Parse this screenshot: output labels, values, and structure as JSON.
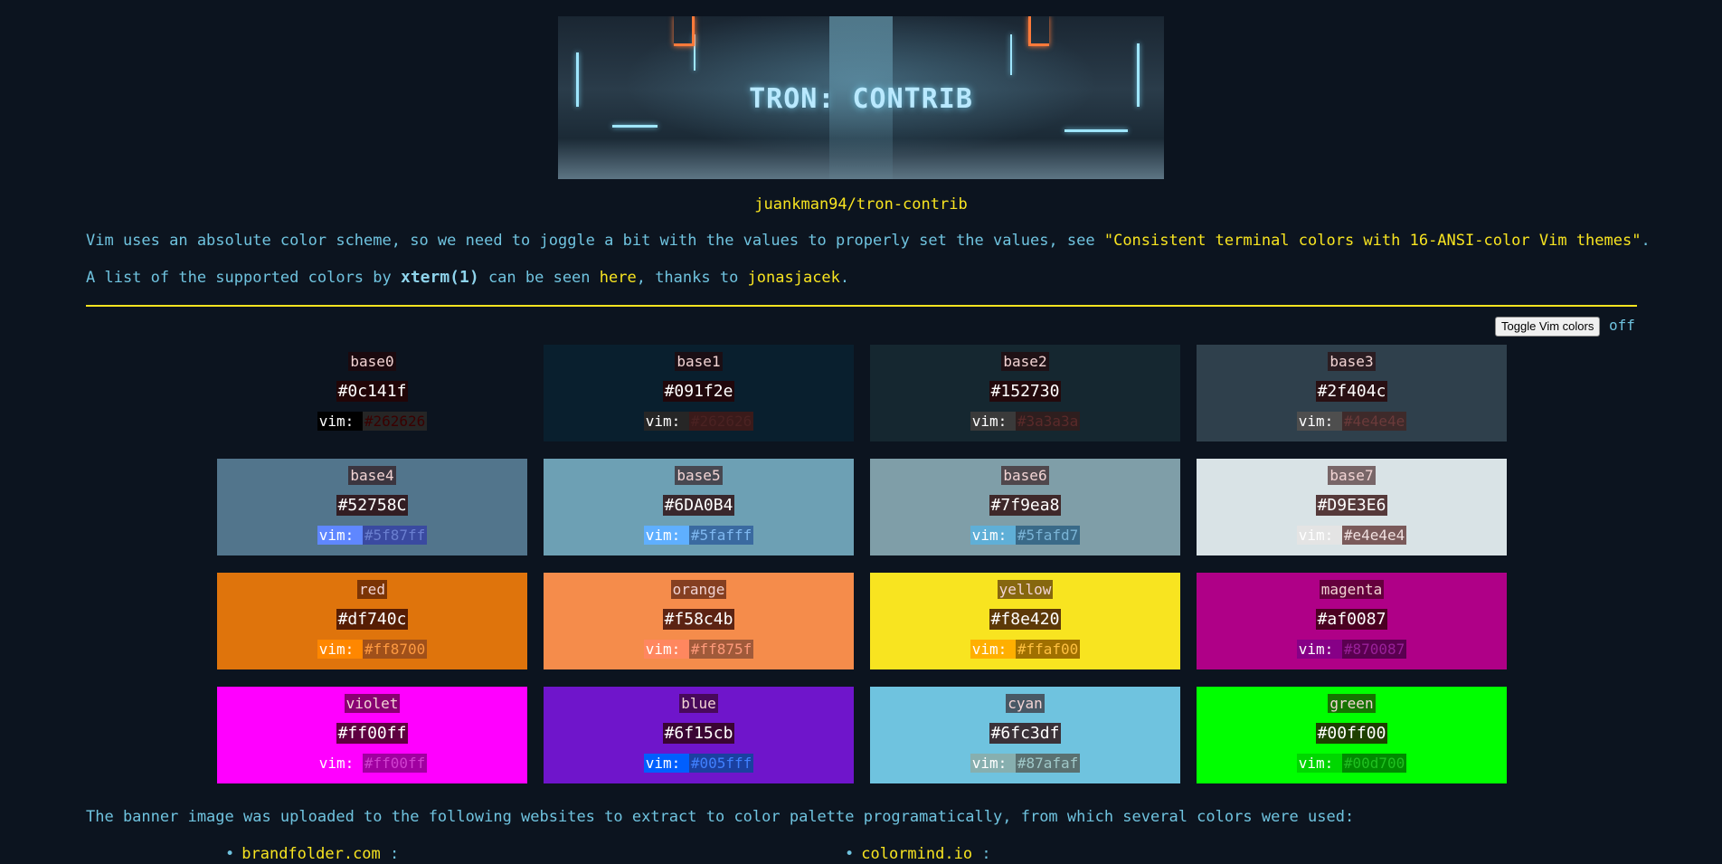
{
  "banner": {
    "title": "TRON: CONTRIB"
  },
  "repo_link": "juankman94/tron-contrib",
  "intro": {
    "p1_text": "Vim uses an absolute color scheme, so we need to joggle a bit with the values to properly set the values, see ",
    "p1_link": "\"Consistent terminal colors with 16-ANSI-color Vim themes\"",
    "p1_end": ".",
    "p2_a": "A list of the supported colors by ",
    "p2_code": "xterm(1)",
    "p2_b": " can be seen ",
    "p2_link1": "here",
    "p2_c": ", thanks to ",
    "p2_link2": "jonasjacek",
    "p2_end": "."
  },
  "toggle": {
    "button_label": "Toggle Vim colors",
    "state": "off"
  },
  "colors": [
    {
      "name": "base0",
      "hex": "#0c141f",
      "vim_label": "vim: ",
      "vim": "#262626",
      "bg": "#0c141f",
      "vim_label_bg": "#000000",
      "vim_bg": "#262626",
      "vim_color": "#3a0000"
    },
    {
      "name": "base1",
      "hex": "#091f2e",
      "vim_label": "vim: ",
      "vim": "#262626",
      "bg": "#091f2e",
      "vim_label_bg": "#262626",
      "vim_bg": "#3a1a1a",
      "vim_color": "#4a2222"
    },
    {
      "name": "base2",
      "hex": "#152730",
      "vim_label": "vim: ",
      "vim": "#3a3a3a",
      "bg": "#152730",
      "vim_label_bg": "#3a3a3a",
      "vim_bg": "#2e1e1e",
      "vim_color": "#5a2a2a"
    },
    {
      "name": "base3",
      "hex": "#2f404c",
      "vim_label": "vim: ",
      "vim": "#4e4e4e",
      "bg": "#2f404c",
      "vim_label_bg": "#4e4e4e",
      "vim_bg": "#3e2a2a",
      "vim_color": "#6a3a3a"
    },
    {
      "name": "base4",
      "hex": "#52758C",
      "vim_label": "vim: ",
      "vim": "#5f87ff",
      "bg": "#52758c",
      "vim_label_bg": "#5f87ff",
      "vim_bg": "#3a4aa0",
      "vim_color": "#6a7fd0"
    },
    {
      "name": "base5",
      "hex": "#6DA0B4",
      "vim_label": "vim: ",
      "vim": "#5fafff",
      "bg": "#6da0b4",
      "vim_label_bg": "#5fafff",
      "vim_bg": "#3a6aa0",
      "vim_color": "#7fb8f0"
    },
    {
      "name": "base6",
      "hex": "#7f9ea8",
      "vim_label": "vim: ",
      "vim": "#5fafd7",
      "bg": "#7f9ea8",
      "vim_label_bg": "#5fafd7",
      "vim_bg": "#3a6a88",
      "vim_color": "#7ab4d6"
    },
    {
      "name": "base7",
      "hex": "#D9E3E6",
      "vim_label": "vim: ",
      "vim": "#e4e4e4",
      "bg": "#d9e3e6",
      "vim_label_bg": "#e4e4e4",
      "vim_bg": "#7a5a5a",
      "vim_color": "#f0e0e0"
    },
    {
      "name": "red",
      "hex": "#df740c",
      "vim_label": "vim: ",
      "vim": "#ff8700",
      "bg": "#df740c",
      "vim_label_bg": "#ff8700",
      "vim_bg": "#a0501a",
      "vim_color": "#ff9a40"
    },
    {
      "name": "orange",
      "hex": "#f58c4b",
      "vim_label": "vim: ",
      "vim": "#ff875f",
      "bg": "#f58c4b",
      "vim_label_bg": "#ff875f",
      "vim_bg": "#a05a3a",
      "vim_color": "#ff9a7a"
    },
    {
      "name": "yellow",
      "hex": "#f8e420",
      "vim_label": "vim: ",
      "vim": "#ffaf00",
      "bg": "#f8e420",
      "vim_label_bg": "#ffaf00",
      "vim_bg": "#a07000",
      "vim_color": "#ffc040"
    },
    {
      "name": "magenta",
      "hex": "#af0087",
      "vim_label": "vim: ",
      "vim": "#870087",
      "bg": "#af0087",
      "vim_label_bg": "#870087",
      "vim_bg": "#5a0050",
      "vim_color": "#9a209a"
    },
    {
      "name": "violet",
      "hex": "#ff00ff",
      "vim_label": "vim: ",
      "vim": "#ff00ff",
      "bg": "#ff00ff",
      "vim_label_bg": "#ff00ff",
      "vim_bg": "#a000a0",
      "vim_color": "#d040d0"
    },
    {
      "name": "blue",
      "hex": "#6f15cb",
      "vim_label": "vim: ",
      "vim": "#005fff",
      "bg": "#6f15cb",
      "vim_label_bg": "#005fff",
      "vim_bg": "#1a40a0",
      "vim_color": "#4080ff"
    },
    {
      "name": "cyan",
      "hex": "#6fc3df",
      "vim_label": "vim: ",
      "vim": "#87afaf",
      "bg": "#6fc3df",
      "vim_label_bg": "#87afaf",
      "vim_bg": "#5a7070",
      "vim_color": "#a0c8c8"
    },
    {
      "name": "green",
      "hex": "#00ff00",
      "vim_label": "vim: ",
      "vim": "#00d700",
      "bg": "#00ff00",
      "vim_label_bg": "#00d700",
      "vim_bg": "#008a00",
      "vim_color": "#20c020"
    }
  ],
  "footer": {
    "text": "The banner image was uploaded to the following websites to extract to color palette programatically, from which several colors were used:",
    "list": [
      {
        "bullet": "•",
        "link": "brandfolder.com",
        "suffix": " :"
      },
      {
        "bullet": "•",
        "link": "colormind.io",
        "suffix": " :"
      }
    ]
  }
}
